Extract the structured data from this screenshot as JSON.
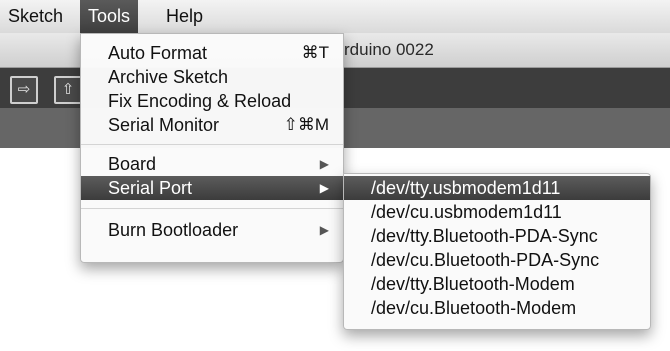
{
  "menubar": {
    "items": [
      "Sketch",
      "Tools",
      "Help"
    ]
  },
  "window": {
    "title_fragment": "rduino 0022"
  },
  "toolbar": {
    "icons": [
      "verify-icon",
      "upload-icon"
    ]
  },
  "tools_menu": {
    "items": [
      {
        "label": "Auto Format",
        "shortcut": "⌘T"
      },
      {
        "label": "Archive Sketch",
        "shortcut": ""
      },
      {
        "label": "Fix Encoding & Reload",
        "shortcut": ""
      },
      {
        "label": "Serial Monitor",
        "shortcut": "⇧⌘M"
      },
      {
        "label": "Board",
        "arrow": "▶"
      },
      {
        "label": "Serial Port",
        "arrow": "▶"
      },
      {
        "label": "Burn Bootloader",
        "arrow": "▶"
      }
    ]
  },
  "serial_port_menu": {
    "items": [
      "/dev/tty.usbmodem1d11",
      "/dev/cu.usbmodem1d11",
      "/dev/tty.Bluetooth-PDA-Sync",
      "/dev/cu.Bluetooth-PDA-Sync",
      "/dev/tty.Bluetooth-Modem",
      "/dev/cu.Bluetooth-Modem"
    ],
    "highlighted_index": 0
  }
}
